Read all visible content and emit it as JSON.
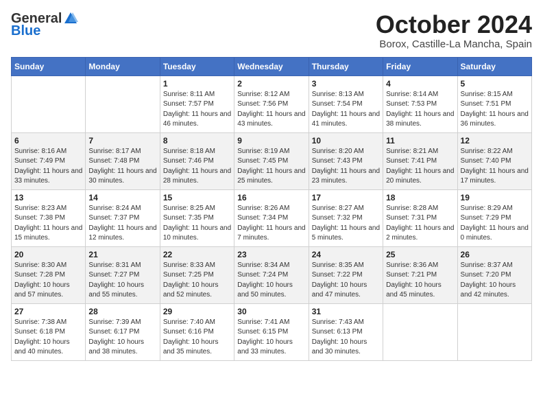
{
  "header": {
    "logo_general": "General",
    "logo_blue": "Blue",
    "month": "October 2024",
    "location": "Borox, Castille-La Mancha, Spain"
  },
  "weekdays": [
    "Sunday",
    "Monday",
    "Tuesday",
    "Wednesday",
    "Thursday",
    "Friday",
    "Saturday"
  ],
  "weeks": [
    [
      {
        "day": "",
        "text": ""
      },
      {
        "day": "",
        "text": ""
      },
      {
        "day": "1",
        "text": "Sunrise: 8:11 AM\nSunset: 7:57 PM\nDaylight: 11 hours and 46 minutes."
      },
      {
        "day": "2",
        "text": "Sunrise: 8:12 AM\nSunset: 7:56 PM\nDaylight: 11 hours and 43 minutes."
      },
      {
        "day": "3",
        "text": "Sunrise: 8:13 AM\nSunset: 7:54 PM\nDaylight: 11 hours and 41 minutes."
      },
      {
        "day": "4",
        "text": "Sunrise: 8:14 AM\nSunset: 7:53 PM\nDaylight: 11 hours and 38 minutes."
      },
      {
        "day": "5",
        "text": "Sunrise: 8:15 AM\nSunset: 7:51 PM\nDaylight: 11 hours and 36 minutes."
      }
    ],
    [
      {
        "day": "6",
        "text": "Sunrise: 8:16 AM\nSunset: 7:49 PM\nDaylight: 11 hours and 33 minutes."
      },
      {
        "day": "7",
        "text": "Sunrise: 8:17 AM\nSunset: 7:48 PM\nDaylight: 11 hours and 30 minutes."
      },
      {
        "day": "8",
        "text": "Sunrise: 8:18 AM\nSunset: 7:46 PM\nDaylight: 11 hours and 28 minutes."
      },
      {
        "day": "9",
        "text": "Sunrise: 8:19 AM\nSunset: 7:45 PM\nDaylight: 11 hours and 25 minutes."
      },
      {
        "day": "10",
        "text": "Sunrise: 8:20 AM\nSunset: 7:43 PM\nDaylight: 11 hours and 23 minutes."
      },
      {
        "day": "11",
        "text": "Sunrise: 8:21 AM\nSunset: 7:41 PM\nDaylight: 11 hours and 20 minutes."
      },
      {
        "day": "12",
        "text": "Sunrise: 8:22 AM\nSunset: 7:40 PM\nDaylight: 11 hours and 17 minutes."
      }
    ],
    [
      {
        "day": "13",
        "text": "Sunrise: 8:23 AM\nSunset: 7:38 PM\nDaylight: 11 hours and 15 minutes."
      },
      {
        "day": "14",
        "text": "Sunrise: 8:24 AM\nSunset: 7:37 PM\nDaylight: 11 hours and 12 minutes."
      },
      {
        "day": "15",
        "text": "Sunrise: 8:25 AM\nSunset: 7:35 PM\nDaylight: 11 hours and 10 minutes."
      },
      {
        "day": "16",
        "text": "Sunrise: 8:26 AM\nSunset: 7:34 PM\nDaylight: 11 hours and 7 minutes."
      },
      {
        "day": "17",
        "text": "Sunrise: 8:27 AM\nSunset: 7:32 PM\nDaylight: 11 hours and 5 minutes."
      },
      {
        "day": "18",
        "text": "Sunrise: 8:28 AM\nSunset: 7:31 PM\nDaylight: 11 hours and 2 minutes."
      },
      {
        "day": "19",
        "text": "Sunrise: 8:29 AM\nSunset: 7:29 PM\nDaylight: 11 hours and 0 minutes."
      }
    ],
    [
      {
        "day": "20",
        "text": "Sunrise: 8:30 AM\nSunset: 7:28 PM\nDaylight: 10 hours and 57 minutes."
      },
      {
        "day": "21",
        "text": "Sunrise: 8:31 AM\nSunset: 7:27 PM\nDaylight: 10 hours and 55 minutes."
      },
      {
        "day": "22",
        "text": "Sunrise: 8:33 AM\nSunset: 7:25 PM\nDaylight: 10 hours and 52 minutes."
      },
      {
        "day": "23",
        "text": "Sunrise: 8:34 AM\nSunset: 7:24 PM\nDaylight: 10 hours and 50 minutes."
      },
      {
        "day": "24",
        "text": "Sunrise: 8:35 AM\nSunset: 7:22 PM\nDaylight: 10 hours and 47 minutes."
      },
      {
        "day": "25",
        "text": "Sunrise: 8:36 AM\nSunset: 7:21 PM\nDaylight: 10 hours and 45 minutes."
      },
      {
        "day": "26",
        "text": "Sunrise: 8:37 AM\nSunset: 7:20 PM\nDaylight: 10 hours and 42 minutes."
      }
    ],
    [
      {
        "day": "27",
        "text": "Sunrise: 7:38 AM\nSunset: 6:18 PM\nDaylight: 10 hours and 40 minutes."
      },
      {
        "day": "28",
        "text": "Sunrise: 7:39 AM\nSunset: 6:17 PM\nDaylight: 10 hours and 38 minutes."
      },
      {
        "day": "29",
        "text": "Sunrise: 7:40 AM\nSunset: 6:16 PM\nDaylight: 10 hours and 35 minutes."
      },
      {
        "day": "30",
        "text": "Sunrise: 7:41 AM\nSunset: 6:15 PM\nDaylight: 10 hours and 33 minutes."
      },
      {
        "day": "31",
        "text": "Sunrise: 7:43 AM\nSunset: 6:13 PM\nDaylight: 10 hours and 30 minutes."
      },
      {
        "day": "",
        "text": ""
      },
      {
        "day": "",
        "text": ""
      }
    ]
  ]
}
